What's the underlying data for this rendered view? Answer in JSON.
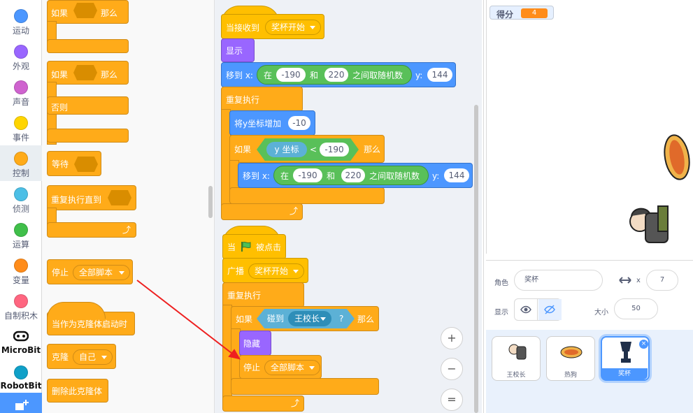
{
  "categories": [
    {
      "label": "运动",
      "color": "#4c97ff"
    },
    {
      "label": "外观",
      "color": "#9966ff"
    },
    {
      "label": "声音",
      "color": "#cf63cf"
    },
    {
      "label": "事件",
      "color": "#ffd500"
    },
    {
      "label": "控制",
      "color": "#ffab19",
      "selected": true
    },
    {
      "label": "侦测",
      "color": "#4cbfe6"
    },
    {
      "label": "运算",
      "color": "#40bf4a"
    },
    {
      "label": "变量",
      "color": "#ff8c1a"
    },
    {
      "label": "自制积木",
      "color": "#ff6680"
    },
    {
      "label": "MicroBit",
      "color": "#1e1e1e"
    },
    {
      "label": "RobotBit",
      "color": "#0fa0c8"
    }
  ],
  "palette": {
    "if1_if": "如果",
    "if1_then": "那么",
    "if2_if": "如果",
    "if2_then": "那么",
    "if2_else": "否则",
    "wait": "等待",
    "repeat_until": "重复执行直到",
    "stop": "停止",
    "stop_option": "全部脚本",
    "clone_start": "当作为克隆体启动时",
    "clone": "克隆",
    "clone_option": "自己",
    "delete_clone": "删除此克隆体"
  },
  "script1": {
    "when_receive": "当接收到",
    "message": "奖杯开始",
    "show": "显示",
    "goto": "移到 x:",
    "in": "在",
    "min": "-190",
    "and": "和",
    "max": "220",
    "random": "之间取随机数",
    "y_label": "y:",
    "y": "144",
    "forever": "重复执行",
    "change_y": "将y坐标增加",
    "change_y_val": "-10",
    "if": "如果",
    "y_pos": "y 坐标",
    "lt": "<",
    "lt_val": "-190",
    "then": "那么",
    "goto2": "移到 x:",
    "in2": "在",
    "min2": "-190",
    "and2": "和",
    "max2": "220",
    "random2": "之间取随机数",
    "y_label2": "y:",
    "y2": "144"
  },
  "script2": {
    "when": "当",
    "flag_clicked": "被点击",
    "broadcast": "广播",
    "message": "奖杯开始",
    "forever": "重复执行",
    "if": "如果",
    "touch": "碰到",
    "touch_target": "王校长",
    "question": "?",
    "then": "那么",
    "hide": "隐藏",
    "stop": "停止",
    "stop_option": "全部脚本"
  },
  "zoom": {
    "in": "+",
    "out": "−",
    "reset": "="
  },
  "stage": {
    "score_label": "得分",
    "score_value": "4"
  },
  "sprite_info": {
    "sprite_label": "角色",
    "sprite_name": "奖杯",
    "x_label": "x",
    "x_value": "7",
    "show_label": "显示",
    "size_label": "大小",
    "size_value": "50"
  },
  "sprites": [
    {
      "name": "王校长"
    },
    {
      "name": "热狗"
    },
    {
      "name": "奖杯",
      "selected": true
    }
  ],
  "colors": {
    "control": "#ffab19",
    "looks": "#9966ff",
    "motion": "#4c97ff",
    "events": "#ffbf00",
    "sensing": "#5cb1d6",
    "operators": "#59c059",
    "accent": "#4c97ff",
    "annotation_arrow": "#ee2020"
  }
}
